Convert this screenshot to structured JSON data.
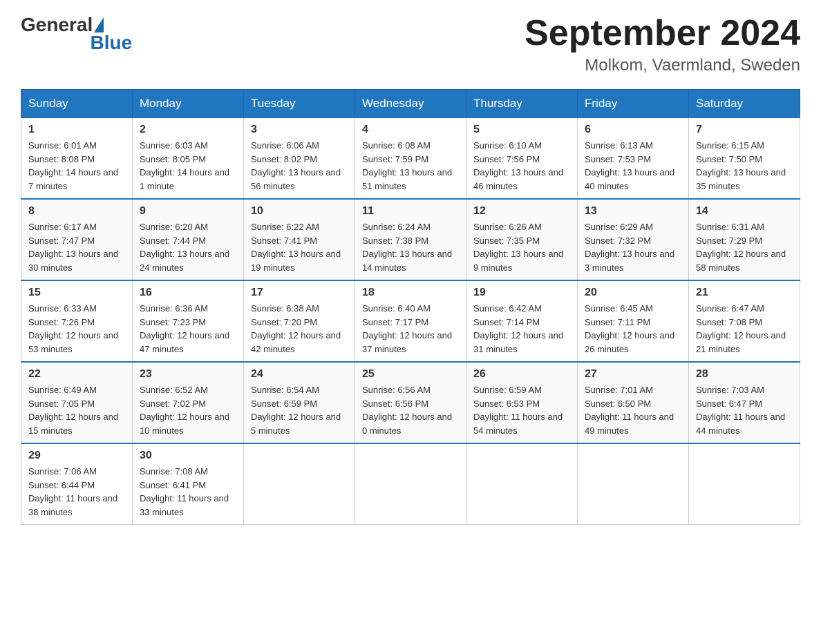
{
  "header": {
    "logo_general": "General",
    "logo_blue": "Blue",
    "title": "September 2024",
    "subtitle": "Molkom, Vaermland, Sweden"
  },
  "weekdays": [
    "Sunday",
    "Monday",
    "Tuesday",
    "Wednesday",
    "Thursday",
    "Friday",
    "Saturday"
  ],
  "weeks": [
    [
      {
        "day": "1",
        "sunrise": "6:01 AM",
        "sunset": "8:08 PM",
        "daylight": "14 hours and 7 minutes."
      },
      {
        "day": "2",
        "sunrise": "6:03 AM",
        "sunset": "8:05 PM",
        "daylight": "14 hours and 1 minute."
      },
      {
        "day": "3",
        "sunrise": "6:06 AM",
        "sunset": "8:02 PM",
        "daylight": "13 hours and 56 minutes."
      },
      {
        "day": "4",
        "sunrise": "6:08 AM",
        "sunset": "7:59 PM",
        "daylight": "13 hours and 51 minutes."
      },
      {
        "day": "5",
        "sunrise": "6:10 AM",
        "sunset": "7:56 PM",
        "daylight": "13 hours and 46 minutes."
      },
      {
        "day": "6",
        "sunrise": "6:13 AM",
        "sunset": "7:53 PM",
        "daylight": "13 hours and 40 minutes."
      },
      {
        "day": "7",
        "sunrise": "6:15 AM",
        "sunset": "7:50 PM",
        "daylight": "13 hours and 35 minutes."
      }
    ],
    [
      {
        "day": "8",
        "sunrise": "6:17 AM",
        "sunset": "7:47 PM",
        "daylight": "13 hours and 30 minutes."
      },
      {
        "day": "9",
        "sunrise": "6:20 AM",
        "sunset": "7:44 PM",
        "daylight": "13 hours and 24 minutes."
      },
      {
        "day": "10",
        "sunrise": "6:22 AM",
        "sunset": "7:41 PM",
        "daylight": "13 hours and 19 minutes."
      },
      {
        "day": "11",
        "sunrise": "6:24 AM",
        "sunset": "7:38 PM",
        "daylight": "13 hours and 14 minutes."
      },
      {
        "day": "12",
        "sunrise": "6:26 AM",
        "sunset": "7:35 PM",
        "daylight": "13 hours and 9 minutes."
      },
      {
        "day": "13",
        "sunrise": "6:29 AM",
        "sunset": "7:32 PM",
        "daylight": "13 hours and 3 minutes."
      },
      {
        "day": "14",
        "sunrise": "6:31 AM",
        "sunset": "7:29 PM",
        "daylight": "12 hours and 58 minutes."
      }
    ],
    [
      {
        "day": "15",
        "sunrise": "6:33 AM",
        "sunset": "7:26 PM",
        "daylight": "12 hours and 53 minutes."
      },
      {
        "day": "16",
        "sunrise": "6:36 AM",
        "sunset": "7:23 PM",
        "daylight": "12 hours and 47 minutes."
      },
      {
        "day": "17",
        "sunrise": "6:38 AM",
        "sunset": "7:20 PM",
        "daylight": "12 hours and 42 minutes."
      },
      {
        "day": "18",
        "sunrise": "6:40 AM",
        "sunset": "7:17 PM",
        "daylight": "12 hours and 37 minutes."
      },
      {
        "day": "19",
        "sunrise": "6:42 AM",
        "sunset": "7:14 PM",
        "daylight": "12 hours and 31 minutes."
      },
      {
        "day": "20",
        "sunrise": "6:45 AM",
        "sunset": "7:11 PM",
        "daylight": "12 hours and 26 minutes."
      },
      {
        "day": "21",
        "sunrise": "6:47 AM",
        "sunset": "7:08 PM",
        "daylight": "12 hours and 21 minutes."
      }
    ],
    [
      {
        "day": "22",
        "sunrise": "6:49 AM",
        "sunset": "7:05 PM",
        "daylight": "12 hours and 15 minutes."
      },
      {
        "day": "23",
        "sunrise": "6:52 AM",
        "sunset": "7:02 PM",
        "daylight": "12 hours and 10 minutes."
      },
      {
        "day": "24",
        "sunrise": "6:54 AM",
        "sunset": "6:59 PM",
        "daylight": "12 hours and 5 minutes."
      },
      {
        "day": "25",
        "sunrise": "6:56 AM",
        "sunset": "6:56 PM",
        "daylight": "12 hours and 0 minutes."
      },
      {
        "day": "26",
        "sunrise": "6:59 AM",
        "sunset": "6:53 PM",
        "daylight": "11 hours and 54 minutes."
      },
      {
        "day": "27",
        "sunrise": "7:01 AM",
        "sunset": "6:50 PM",
        "daylight": "11 hours and 49 minutes."
      },
      {
        "day": "28",
        "sunrise": "7:03 AM",
        "sunset": "6:47 PM",
        "daylight": "11 hours and 44 minutes."
      }
    ],
    [
      {
        "day": "29",
        "sunrise": "7:06 AM",
        "sunset": "6:44 PM",
        "daylight": "11 hours and 38 minutes."
      },
      {
        "day": "30",
        "sunrise": "7:08 AM",
        "sunset": "6:41 PM",
        "daylight": "11 hours and 33 minutes."
      },
      null,
      null,
      null,
      null,
      null
    ]
  ],
  "labels": {
    "sunrise": "Sunrise:",
    "sunset": "Sunset:",
    "daylight": "Daylight:"
  }
}
